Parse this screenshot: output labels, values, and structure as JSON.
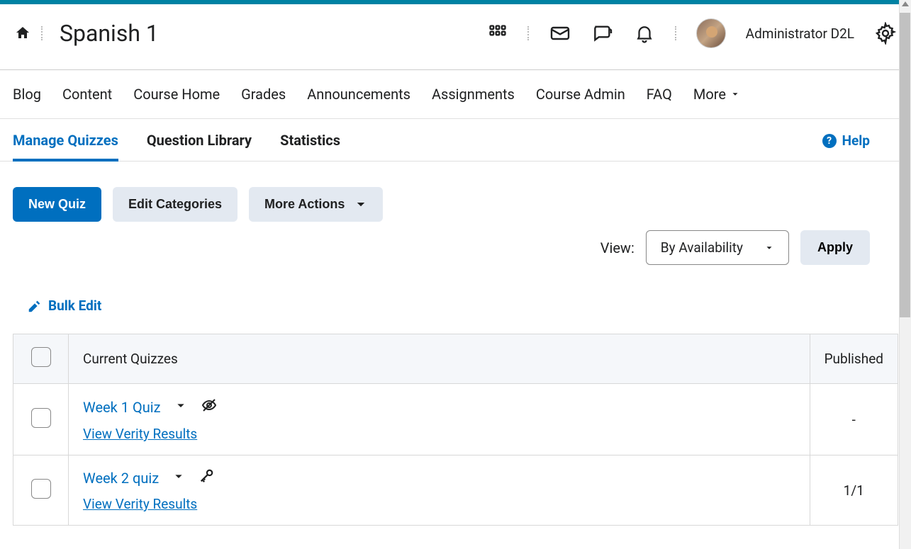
{
  "header": {
    "course_title": "Spanish 1",
    "user_name": "Administrator D2L"
  },
  "nav": {
    "items": [
      "Blog",
      "Content",
      "Course Home",
      "Grades",
      "Announcements",
      "Assignments",
      "Course Admin",
      "FAQ"
    ],
    "more": "More"
  },
  "sub_tabs": {
    "items": [
      "Manage Quizzes",
      "Question Library",
      "Statistics"
    ],
    "active_index": 0,
    "help": "Help"
  },
  "actions": {
    "new_quiz": "New Quiz",
    "edit_categories": "Edit Categories",
    "more_actions": "More Actions"
  },
  "view": {
    "label": "View:",
    "selected": "By Availability",
    "apply": "Apply"
  },
  "bulk_edit": "Bulk Edit",
  "table": {
    "col_quizzes": "Current Quizzes",
    "col_published": "Published",
    "rows": [
      {
        "title": "Week 1 Quiz",
        "verity": "View Verity Results",
        "icon": "hidden",
        "published": "-"
      },
      {
        "title": "Week 2 quiz",
        "verity": "View Verity Results",
        "icon": "special",
        "published": "1/1"
      }
    ]
  }
}
